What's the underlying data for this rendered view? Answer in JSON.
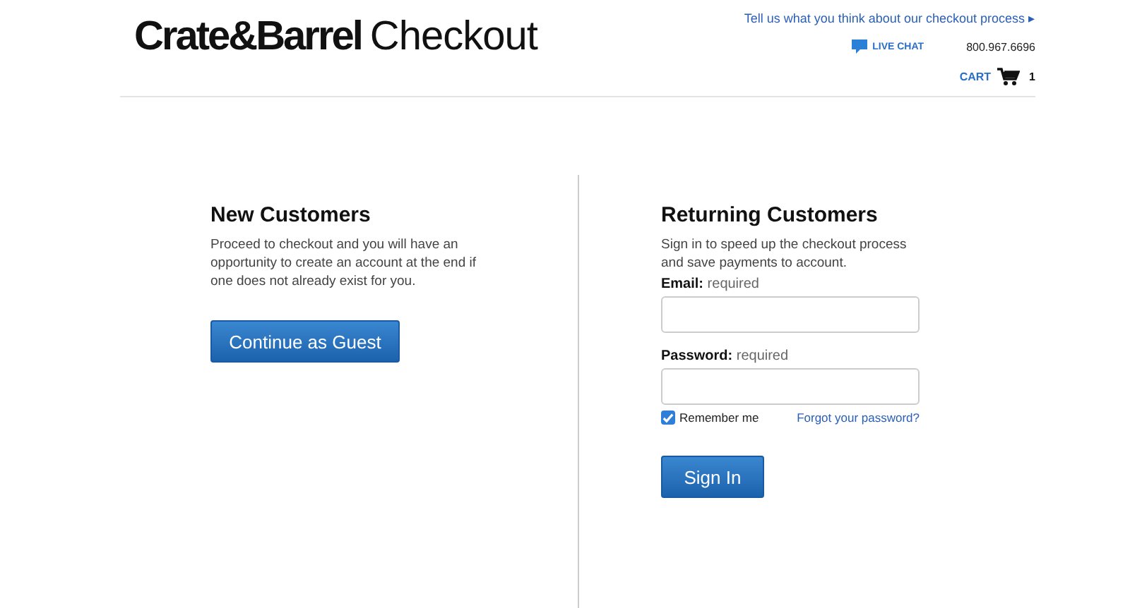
{
  "header": {
    "brand": "Crate&Barrel",
    "title": "Checkout",
    "feedback_link": "Tell us what you think about our checkout process",
    "feedback_arrow": "▸",
    "live_chat": "LIVE CHAT",
    "phone": "800.967.6696",
    "cart": {
      "label": "CART",
      "count": "1"
    }
  },
  "new_customers": {
    "heading": "New Customers",
    "text": "Proceed to checkout and you will have an opportunity to create an account at the end if one does not already exist for you.",
    "button": "Continue as Guest"
  },
  "returning_customers": {
    "heading": "Returning Customers",
    "text": "Sign in to speed up the checkout process and save payments to account.",
    "fields": [
      {
        "label": "Email:",
        "hint": "required"
      },
      {
        "label": "Password:",
        "hint": "required"
      }
    ],
    "remember": {
      "label": "Remember me",
      "checked": true
    },
    "forgot_link": "Forgot your password?",
    "button": "Sign In"
  }
}
